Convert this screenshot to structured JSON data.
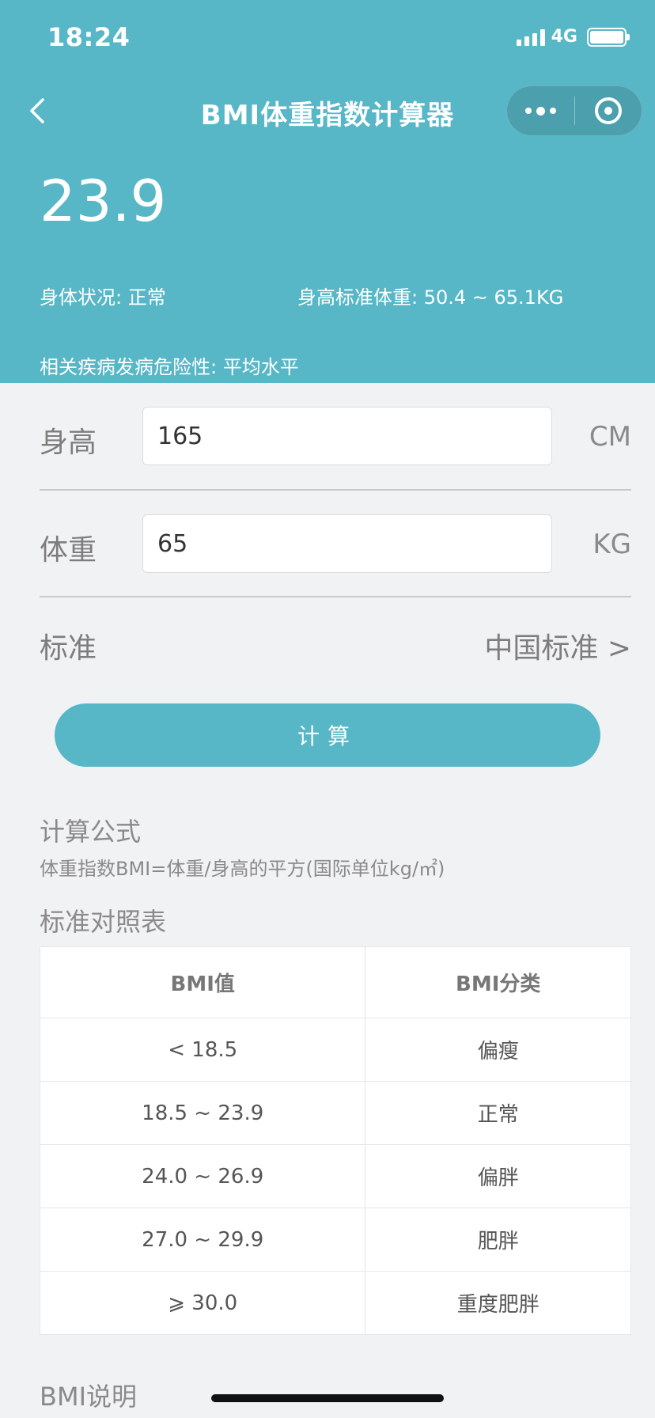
{
  "status_bar": {
    "time": "18:24",
    "network": "4G"
  },
  "nav": {
    "back_icon": "chevron-left-icon",
    "title": "BMI体重指数计算器",
    "more_icon": "more-dots-icon",
    "close_icon": "target-close-icon"
  },
  "result": {
    "bmi": "23.9",
    "status": "身体状况: 正常",
    "standard_weight": "身高标准体重: 50.4 ~ 65.1KG",
    "risk": "相关疾病发病危险性: 平均水平"
  },
  "form": {
    "height_label": "身高",
    "height_value": "165",
    "height_unit": "CM",
    "weight_label": "体重",
    "weight_value": "65",
    "weight_unit": "KG",
    "standard_label": "标准",
    "standard_value": "中国标准 >"
  },
  "calc_button": "计算",
  "formula": {
    "title": "计算公式",
    "text": "体重指数BMI=体重/身高的平方(国际单位kg/㎡)"
  },
  "reference": {
    "title": "标准对照表",
    "headers": [
      "BMI值",
      "BMI分类"
    ],
    "rows": [
      [
        "< 18.5",
        "偏瘦"
      ],
      [
        "18.5 ~ 23.9",
        "正常"
      ],
      [
        "24.0 ~ 26.9",
        "偏胖"
      ],
      [
        "27.0 ~ 29.9",
        "肥胖"
      ],
      [
        "⩾ 30.0",
        "重度肥胖"
      ]
    ]
  },
  "bmi_note_title": "BMI说明",
  "colors": {
    "accent": "#57b7c7",
    "background": "#f1f2f4"
  }
}
